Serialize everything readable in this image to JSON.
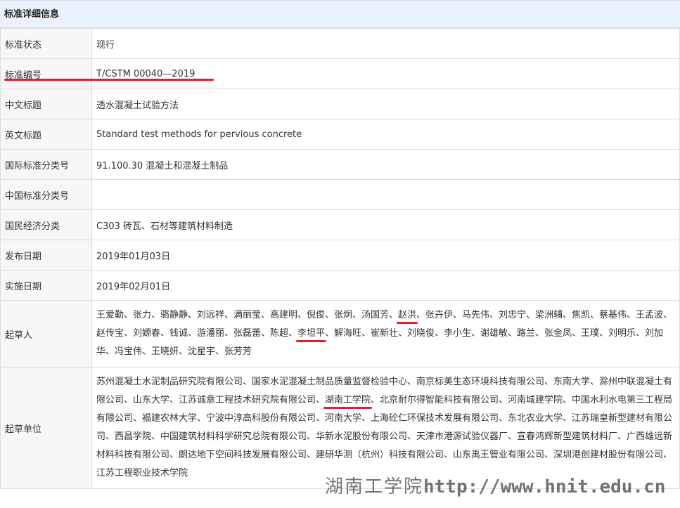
{
  "header": {
    "title": "标准详细信息"
  },
  "rows": {
    "status": {
      "label": "标准状态",
      "value": "现行"
    },
    "number": {
      "label": "标准编号",
      "value": "T/CSTM 00040—2019"
    },
    "cn_title": {
      "label": "中文标题",
      "value": "透水混凝土试验方法"
    },
    "en_title": {
      "label": "英文标题",
      "value": "Standard test methods for pervious concrete"
    },
    "ics": {
      "label": "国际标准分类号",
      "value": "91.100.30 混凝土和混凝土制品"
    },
    "ccs": {
      "label": "中国标准分类号",
      "value": ""
    },
    "nec": {
      "label": "国民经济分类",
      "value": "C303 砖瓦、石材等建筑材料制造"
    },
    "pub_date": {
      "label": "发布日期",
      "value": "2019年01月03日"
    },
    "impl_date": {
      "label": "实施日期",
      "value": "2019年02月01日"
    },
    "drafters": {
      "label": "起草人",
      "t1": "王爱勤、张力、骆静静、刘远祥、满丽莹、高建明、倪俊、张炯、汤国芳、",
      "h1": "赵洪",
      "t2": "、张卉伊、马先伟、刘忠宁、梁洲辅、焦凯、蔡基伟、王孟波、赵传宝、刘嫄春、钱诚、游潘丽、张磊蕾、陈超、",
      "h2": "李坦平",
      "t3": "、解海旺、崔新壮、刘晓俊、李小生、谢雄敏、路兰、张金凤、王璞、刘明乐、刘加华、冯宝伟、王晓妍、沈星宇、张芳芳"
    },
    "units": {
      "label": "起草单位",
      "t1": "苏州混凝土水泥制品研究院有限公司、国家水泥混凝土制品质量监督检验中心、南京标美生态环境科技有限公司、东南大学、滁州中联混凝土有限公司、山东大学、江苏诚意工程技术研究院有限公司、",
      "h1": "湖南工学院",
      "t2": "、北京耐尔得智能科技有限公司、河南城建学院、中国水利水电第三工程局有限公司、福建农林大学、宁波中淳高科股份有限公司、河南大学、上海砼仁环保技术发展有限公司、东北农业大学、江苏瑞皇新型建材有限公司、西昌学院、中国建筑材料科学研究总院有限公司、华新水泥股份有限公司、天津市港源试验仪器厂、宣春鸿辉新型建筑材料厂、广西雄远新材料科技有限公司、朗达地下空间科技发展有限公司、建研华测（杭州）科技有限公司、山东禹王管业有限公司、深圳港创建材股份有限公司、江苏工程职业技术学院"
    }
  },
  "watermark": {
    "cn": "湖南工学院",
    "url": "http://www.hnit.edu.cn"
  },
  "colors": {
    "highlight": "#e0202a",
    "header_bg": "#eaf2fb",
    "label_bg": "#f7f7f7"
  }
}
